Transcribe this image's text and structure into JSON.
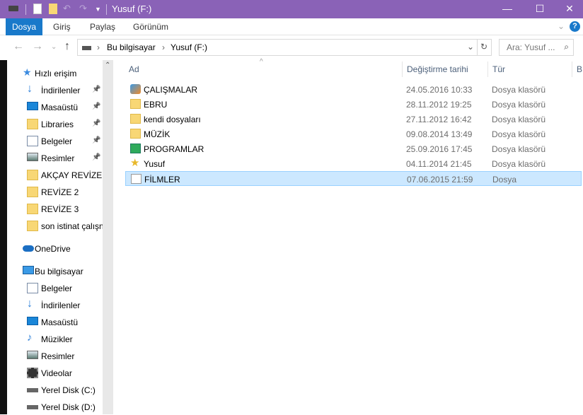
{
  "window": {
    "title": "Yusuf (F:)",
    "minimize": "—",
    "maximize": "☐",
    "close": "✕"
  },
  "ribbon": {
    "tabs": [
      "Dosya",
      "Giriş",
      "Paylaş",
      "Görünüm"
    ],
    "help": "?"
  },
  "address": {
    "crumbs": [
      "Bu bilgisayar",
      "Yusuf (F:)"
    ],
    "search_placeholder": "Ara: Yusuf ..."
  },
  "sidebar": {
    "items": [
      {
        "label": "Hızlı erişim",
        "icon": "star-icon",
        "level": 0,
        "pinned": false
      },
      {
        "label": "İndirilenler",
        "icon": "download-icon",
        "level": 1,
        "pinned": true
      },
      {
        "label": "Masaüstü",
        "icon": "desktop-icon",
        "level": 1,
        "pinned": true
      },
      {
        "label": "Libraries",
        "icon": "folder-icon",
        "level": 1,
        "pinned": true
      },
      {
        "label": "Belgeler",
        "icon": "document-icon",
        "level": 1,
        "pinned": true
      },
      {
        "label": "Resimler",
        "icon": "pictures-icon",
        "level": 1,
        "pinned": true
      },
      {
        "label": "AKÇAY REVİZE D",
        "icon": "folder-icon",
        "level": 1,
        "pinned": false
      },
      {
        "label": "REVİZE 2",
        "icon": "folder-icon",
        "level": 1,
        "pinned": false
      },
      {
        "label": "REVİZE 3",
        "icon": "folder-icon",
        "level": 1,
        "pinned": false
      },
      {
        "label": "son istinat çalışn",
        "icon": "folder-icon",
        "level": 1,
        "pinned": false
      },
      {
        "label": "OneDrive",
        "icon": "cloud-icon",
        "level": 0,
        "pinned": false
      },
      {
        "label": "Bu bilgisayar",
        "icon": "computer-icon",
        "level": 0,
        "pinned": false
      },
      {
        "label": "Belgeler",
        "icon": "document-icon",
        "level": 1,
        "pinned": false
      },
      {
        "label": "İndirilenler",
        "icon": "download-icon",
        "level": 1,
        "pinned": false
      },
      {
        "label": "Masaüstü",
        "icon": "desktop-icon",
        "level": 1,
        "pinned": false
      },
      {
        "label": "Müzikler",
        "icon": "music-icon",
        "level": 1,
        "pinned": false
      },
      {
        "label": "Resimler",
        "icon": "pictures-icon",
        "level": 1,
        "pinned": false
      },
      {
        "label": "Videolar",
        "icon": "video-icon",
        "level": 1,
        "pinned": false
      },
      {
        "label": "Yerel Disk (C:)",
        "icon": "drive-icon",
        "level": 1,
        "pinned": false
      },
      {
        "label": "Yerel Disk (D:)",
        "icon": "drive-icon",
        "level": 1,
        "pinned": false
      }
    ]
  },
  "columns": {
    "name": "Ad",
    "date": "Değiştirme tarihi",
    "type": "Tür",
    "size": "B"
  },
  "files": [
    {
      "name": "ÇALIŞMALAR",
      "date": "24.05.2016 10:33",
      "type": "Dosya klasörü",
      "icon": "special-folder-icon"
    },
    {
      "name": "EBRU",
      "date": "28.11.2012 19:25",
      "type": "Dosya klasörü",
      "icon": "folder-icon"
    },
    {
      "name": "kendi dosyaları",
      "date": "27.11.2012 16:42",
      "type": "Dosya klasörü",
      "icon": "folder-icon"
    },
    {
      "name": "MÜZİK",
      "date": "09.08.2014 13:49",
      "type": "Dosya klasörü",
      "icon": "folder-icon"
    },
    {
      "name": "PROGRAMLAR",
      "date": "25.09.2016 17:45",
      "type": "Dosya klasörü",
      "icon": "program-folder-icon"
    },
    {
      "name": "Yusuf",
      "date": "04.11.2014 21:45",
      "type": "Dosya klasörü",
      "icon": "star-folder-icon"
    },
    {
      "name": "FİLMLER",
      "date": "07.06.2015 21:59",
      "type": "Dosya",
      "icon": "file-icon",
      "selected": true
    }
  ]
}
